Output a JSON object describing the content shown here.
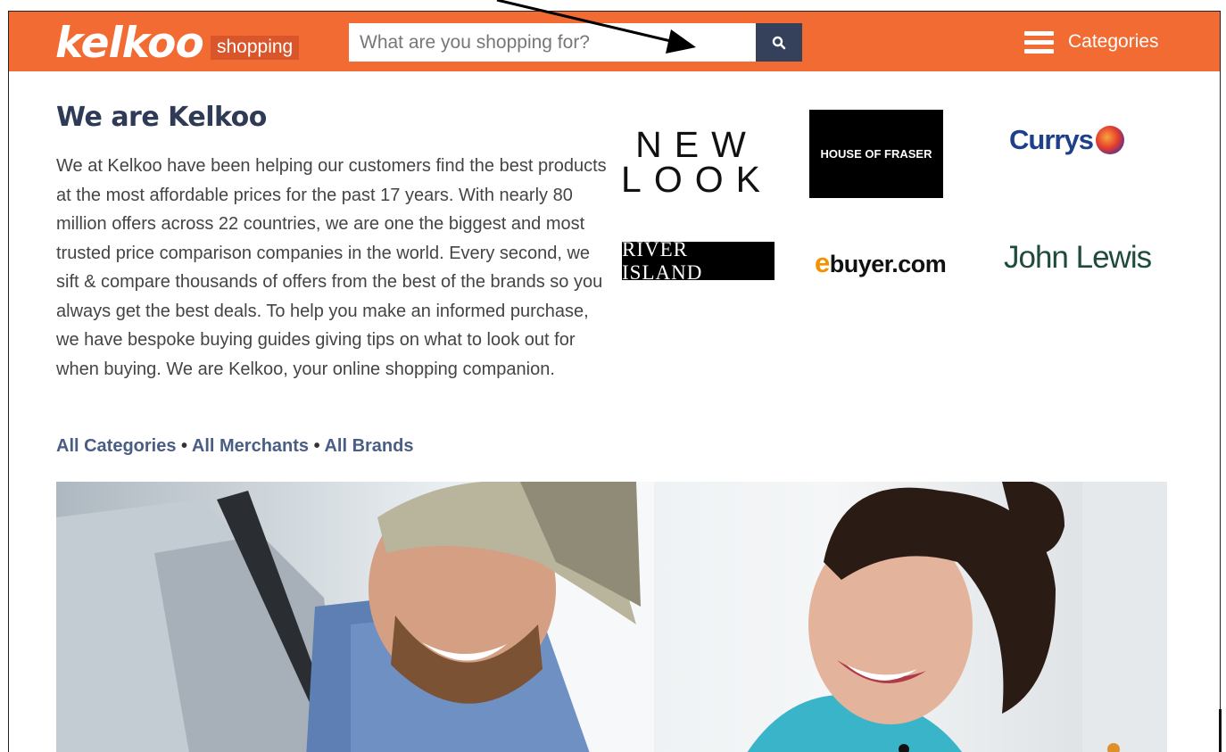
{
  "header": {
    "logo_text": "kelkoo",
    "logo_tag": "shopping",
    "search": {
      "placeholder": "What are you shopping for?"
    },
    "search_button_icon": "search-icon",
    "categories_icon": "hamburger-menu-icon",
    "categories_label": "Categories"
  },
  "colors": {
    "header_bg": "#f26b33",
    "search_button_bg": "#35415a",
    "heading": "#2f3b56",
    "link": "#4a5d85"
  },
  "intro": {
    "heading": "We are Kelkoo",
    "body": "We at Kelkoo have been helping our customers find the best products at the most affordable prices for the past 17 years. With nearly 80 million offers across 22 countries, we are one the biggest and most trusted price comparison companies in the world. Every second, we sift & compare thousands of offers from the best of the brands so you always get the best deals. To help you make an informed purchase, we have bespoke buying guides giving tips on what to look out for when buying. We are Kelkoo, your online shopping companion."
  },
  "links": {
    "all_categories": "All Categories",
    "all_merchants": "All Merchants",
    "all_brands": "All Brands",
    "separator": "•"
  },
  "brands": {
    "new_look": "NEW LOOK",
    "house_of_fraser": "HOUSE OF FRASER",
    "currys": "Currys",
    "river_island": "RIVER ISLAND",
    "ebuyer": "ebuyer.com",
    "john_lewis": "John Lewis"
  }
}
